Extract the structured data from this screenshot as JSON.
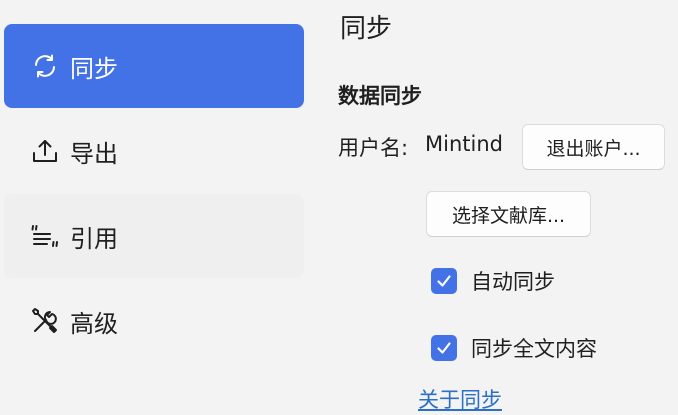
{
  "sidebar": {
    "items": [
      {
        "label": "同步",
        "icon": "sync-icon",
        "active": true
      },
      {
        "label": "导出",
        "icon": "upload-icon",
        "active": false
      },
      {
        "label": "引用",
        "icon": "cite-icon",
        "active": false
      },
      {
        "label": "高级",
        "icon": "tools-icon",
        "active": false
      }
    ]
  },
  "main": {
    "title": "同步",
    "section_title": "数据同步",
    "username_label": "用户名:",
    "username_value": "Mintind",
    "logout_button": "退出账户...",
    "library_button": "选择文献库...",
    "auto_sync_label": "自动同步",
    "auto_sync_checked": true,
    "full_text_label": "同步全文内容",
    "full_text_checked": true,
    "about_link": "关于同步"
  },
  "colors": {
    "accent": "#4272e6",
    "background": "#f3f3f3",
    "link": "#2b6fc7"
  }
}
